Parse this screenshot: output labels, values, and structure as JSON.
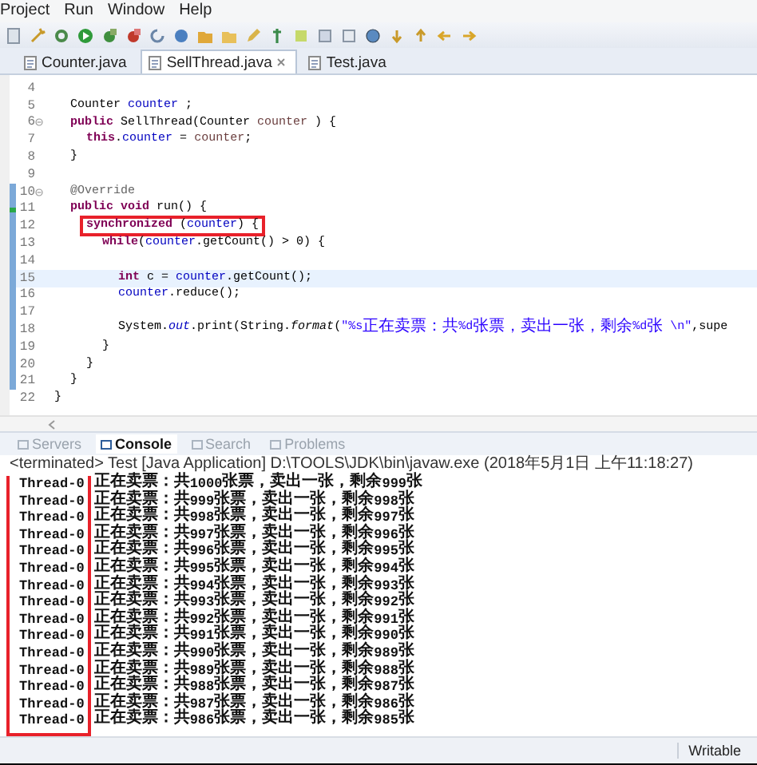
{
  "menu": [
    "Project",
    "Run",
    "Window",
    "Help"
  ],
  "editor_tabs": [
    {
      "label": "Counter.java",
      "selected": false
    },
    {
      "label": "SellThread.java",
      "selected": true
    },
    {
      "label": "Test.java",
      "selected": false
    }
  ],
  "code": {
    "body": [
      {
        "number": "4",
        "current": false,
        "in_range": false,
        "foldable": false,
        "override_marker": false
      },
      {
        "number": "5",
        "tokens": [
          {
            "kind": "plain",
            "text": "Counter "
          },
          {
            "kind": "field",
            "text": "counter"
          },
          {
            "kind": "plain",
            "text": " ;"
          }
        ],
        "current": false,
        "in_range": false,
        "boxed": false,
        "foldable": false,
        "override_marker": false
      },
      {
        "number": "6",
        "tokens": [
          {
            "kind": "keyword",
            "text": "public"
          },
          {
            "kind": "plain",
            "text": " SellThread(Counter "
          },
          {
            "kind": "local",
            "text": "counter"
          },
          {
            "kind": "plain",
            "text": " ) {"
          }
        ],
        "current": false,
        "in_range": false,
        "boxed": false,
        "foldable": true,
        "override_marker": false,
        "children": [
          {
            "number": "7",
            "tokens": [
              {
                "kind": "keyword",
                "text": "this"
              },
              {
                "kind": "plain",
                "text": "."
              },
              {
                "kind": "field",
                "text": "counter"
              },
              {
                "kind": "plain",
                "text": " = "
              },
              {
                "kind": "local",
                "text": "counter"
              },
              {
                "kind": "plain",
                "text": ";"
              }
            ],
            "current": false,
            "in_range": false,
            "boxed": false,
            "foldable": false,
            "override_marker": false
          }
        ]
      },
      {
        "number": "8",
        "tokens": [
          {
            "kind": "plain",
            "text": "}"
          }
        ],
        "current": false,
        "in_range": false,
        "boxed": false,
        "foldable": false,
        "override_marker": false
      },
      {
        "number": "9",
        "current": false,
        "in_range": false,
        "foldable": false,
        "override_marker": false
      },
      {
        "number": "10",
        "tokens": [
          {
            "kind": "annotation",
            "text": "@Override"
          }
        ],
        "current": false,
        "in_range": true,
        "boxed": false,
        "foldable": true,
        "override_marker": false
      },
      {
        "number": "11",
        "tokens": [
          {
            "kind": "keyword",
            "text": "public"
          },
          {
            "kind": "keyword",
            "text": " void"
          },
          {
            "kind": "plain",
            "text": " run() {"
          }
        ],
        "current": false,
        "in_range": true,
        "boxed": false,
        "foldable": false,
        "override_marker": true,
        "children": [
          {
            "number": "12",
            "tokens": [
              {
                "kind": "keyword",
                "text": "synchronized"
              },
              {
                "kind": "plain",
                "text": " ("
              },
              {
                "kind": "field",
                "text": "counter"
              },
              {
                "kind": "plain",
                "text": ") {"
              }
            ],
            "current": false,
            "in_range": true,
            "boxed": true,
            "foldable": false,
            "override_marker": false,
            "children": [
              {
                "number": "13",
                "tokens": [
                  {
                    "kind": "keyword",
                    "text": "while"
                  },
                  {
                    "kind": "plain",
                    "text": "("
                  },
                  {
                    "kind": "field",
                    "text": "counter"
                  },
                  {
                    "kind": "plain",
                    "text": ".getCount() > 0) {"
                  }
                ],
                "current": false,
                "in_range": true,
                "boxed": false,
                "foldable": false,
                "override_marker": false,
                "children": [
                  {
                    "number": "14",
                    "current": false,
                    "in_range": true,
                    "foldable": false,
                    "override_marker": false
                  },
                  {
                    "number": "15",
                    "tokens": [
                      {
                        "kind": "keyword",
                        "text": "int"
                      },
                      {
                        "kind": "plain",
                        "text": " c = "
                      },
                      {
                        "kind": "field",
                        "text": "counter"
                      },
                      {
                        "kind": "plain",
                        "text": ".getCount();"
                      }
                    ],
                    "current": true,
                    "in_range": true,
                    "boxed": false,
                    "foldable": false,
                    "override_marker": false
                  },
                  {
                    "number": "16",
                    "tokens": [
                      {
                        "kind": "field",
                        "text": "counter"
                      },
                      {
                        "kind": "plain",
                        "text": ".reduce();"
                      }
                    ],
                    "current": false,
                    "in_range": true,
                    "boxed": false,
                    "foldable": false,
                    "override_marker": false
                  },
                  {
                    "number": "17",
                    "current": false,
                    "in_range": true,
                    "foldable": false,
                    "override_marker": false
                  },
                  {
                    "number": "18",
                    "tokens": [
                      {
                        "kind": "plain",
                        "text": "System."
                      },
                      {
                        "kind": "static",
                        "text": "out"
                      },
                      {
                        "kind": "plain",
                        "text": ".print(String."
                      },
                      {
                        "kind": "static_method",
                        "text": "format"
                      },
                      {
                        "kind": "plain",
                        "text": "("
                      },
                      {
                        "kind": "string",
                        "text": "\"%s正在卖票：共%d张票，卖出一张，剩余%d张 \\n\""
                      },
                      {
                        "kind": "plain",
                        "text": ",supe"
                      }
                    ],
                    "current": false,
                    "in_range": true,
                    "boxed": false,
                    "foldable": false,
                    "override_marker": false
                  }
                ]
              },
              {
                "number": "19",
                "tokens": [
                  {
                    "kind": "plain",
                    "text": "}"
                  }
                ],
                "current": false,
                "in_range": true,
                "boxed": false,
                "foldable": false,
                "override_marker": false
              }
            ]
          },
          {
            "number": "20",
            "tokens": [
              {
                "kind": "plain",
                "text": "}"
              }
            ],
            "current": false,
            "in_range": true,
            "boxed": false,
            "foldable": false,
            "override_marker": false
          }
        ]
      },
      {
        "number": "21",
        "tokens": [
          {
            "kind": "plain",
            "text": "}"
          }
        ],
        "current": false,
        "in_range": true,
        "boxed": false,
        "foldable": false,
        "override_marker": false
      }
    ],
    "end": {
      "number": "22",
      "tokens": [
        {
          "kind": "plain",
          "text": "}"
        }
      ],
      "current": false,
      "in_range": false,
      "boxed": false,
      "foldable": false,
      "override_marker": false
    }
  },
  "view_tabs": [
    {
      "label": "Servers",
      "selected": false
    },
    {
      "label": "Console",
      "selected": true
    },
    {
      "label": "Search",
      "selected": false
    },
    {
      "label": "Problems",
      "selected": false
    }
  ],
  "console": {
    "header": "<terminated> Test [Java Application] D:\\TOOLS\\JDK\\bin\\javaw.exe (2018年5月1日 上午11:18:27)",
    "thread_column_boxed": true,
    "lines": [
      {
        "thread": "Thread-0",
        "message": "正在卖票：共1000张票，卖出一张，剩余999张"
      },
      {
        "thread": "Thread-0",
        "message": "正在卖票：共999张票，卖出一张，剩余998张"
      },
      {
        "thread": "Thread-0",
        "message": "正在卖票：共998张票，卖出一张，剩余997张"
      },
      {
        "thread": "Thread-0",
        "message": "正在卖票：共997张票，卖出一张，剩余996张"
      },
      {
        "thread": "Thread-0",
        "message": "正在卖票：共996张票，卖出一张，剩余995张"
      },
      {
        "thread": "Thread-0",
        "message": "正在卖票：共995张票，卖出一张，剩余994张"
      },
      {
        "thread": "Thread-0",
        "message": "正在卖票：共994张票，卖出一张，剩余993张"
      },
      {
        "thread": "Thread-0",
        "message": "正在卖票：共993张票，卖出一张，剩余992张"
      },
      {
        "thread": "Thread-0",
        "message": "正在卖票：共992张票，卖出一张，剩余991张"
      },
      {
        "thread": "Thread-0",
        "message": "正在卖票：共991张票，卖出一张，剩余990张"
      },
      {
        "thread": "Thread-0",
        "message": "正在卖票：共990张票，卖出一张，剩余989张"
      },
      {
        "thread": "Thread-0",
        "message": "正在卖票：共989张票，卖出一张，剩余988张"
      },
      {
        "thread": "Thread-0",
        "message": "正在卖票：共988张票，卖出一张，剩余987张"
      },
      {
        "thread": "Thread-0",
        "message": "正在卖票：共987张票，卖出一张，剩余986张"
      },
      {
        "thread": "Thread-0",
        "message": "正在卖票：共986张票，卖出一张，剩余985张"
      }
    ]
  },
  "status_bar": {
    "mode": "Writable"
  }
}
